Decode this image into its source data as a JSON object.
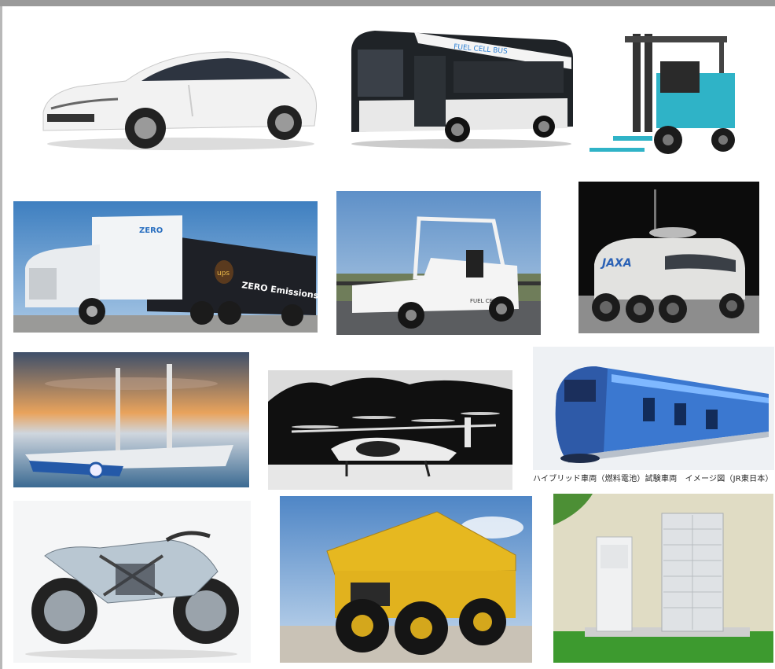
{
  "tiles": [
    {
      "id": "car",
      "subject": "white fuel cell sedan"
    },
    {
      "id": "bus",
      "subject": "fuel cell bus",
      "label": "FUEL CELL BUS"
    },
    {
      "id": "forklift",
      "subject": "fuel cell forklift"
    },
    {
      "id": "truck",
      "subject": "UPS zero emissions semi truck",
      "cab_label": "ZERO",
      "trailer_label": "ZERO Emissions Delivery",
      "logo_label": "ups"
    },
    {
      "id": "tow-tractor",
      "subject": "fuel cell airport tow tractor",
      "label": "FUEL CELL"
    },
    {
      "id": "lunar-rover",
      "subject": "JAXA lunar rover",
      "label": "JAXA"
    },
    {
      "id": "boat",
      "subject": "hydrogen catamaran at sunset"
    },
    {
      "id": "evtol",
      "subject": "air taxi eVTOL aircraft"
    },
    {
      "id": "train",
      "subject": "hybrid fuel cell train"
    },
    {
      "id": "motorcycle",
      "subject": "fuel cell motorcycle"
    },
    {
      "id": "dump-truck",
      "subject": "yellow mining dump truck"
    },
    {
      "id": "home-unit",
      "subject": "residential fuel cell and storage units"
    }
  ],
  "train_caption": "ハイブリッド車両（燃料電池）試験車両　イメージ図（JR東日本）",
  "colors": {
    "frame": "#9a9a9a",
    "sky": "#5d8fc4",
    "yellow": "#e6b820",
    "teal": "#2fb3c7",
    "ups_brown": "#5a3a1e",
    "grass": "#3d9a2f"
  }
}
